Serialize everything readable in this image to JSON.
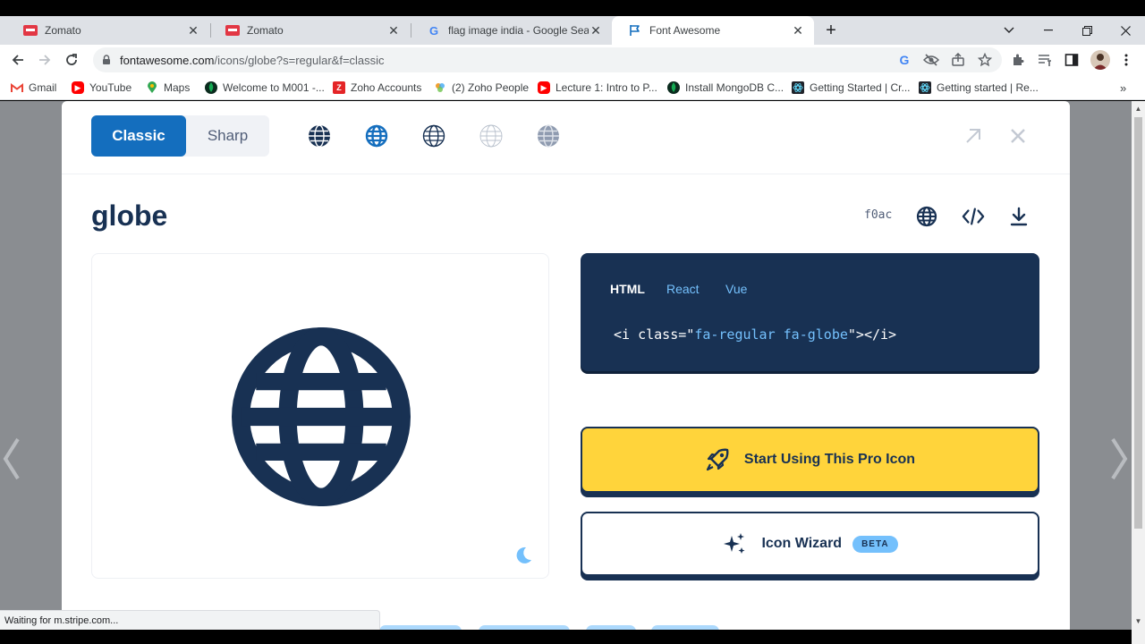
{
  "browser": {
    "tabs": [
      {
        "title": "Zomato",
        "favicon": "zomato-icon",
        "active": false
      },
      {
        "title": "Zomato",
        "favicon": "zomato-icon",
        "active": false
      },
      {
        "title": "flag image india - Google Search",
        "favicon": "google-icon",
        "active": false
      },
      {
        "title": "Font Awesome",
        "favicon": "flag-icon",
        "active": true
      }
    ],
    "url_host": "fontawesome.com",
    "url_path": "/icons/globe?s=regular&f=classic",
    "bookmarks": [
      {
        "label": "Gmail",
        "icon": "gmail-icon"
      },
      {
        "label": "YouTube",
        "icon": "youtube-icon"
      },
      {
        "label": "Maps",
        "icon": "maps-icon"
      },
      {
        "label": "Welcome to M001 -...",
        "icon": "mongodb-icon"
      },
      {
        "label": "Zoho Accounts",
        "icon": "zoho-icon"
      },
      {
        "label": "(2) Zoho People",
        "icon": "zoho-people-icon"
      },
      {
        "label": "Lecture 1: Intro to P...",
        "icon": "youtube-icon"
      },
      {
        "label": "Install MongoDB C...",
        "icon": "mongodb-icon"
      },
      {
        "label": "Getting Started | Cr...",
        "icon": "react-icon"
      },
      {
        "label": "Getting started | Re...",
        "icon": "react-icon"
      }
    ],
    "status": "Waiting for m.stripe.com..."
  },
  "modal": {
    "family_tabs": {
      "classic": "Classic",
      "sharp": "Sharp"
    },
    "icon_name": "globe",
    "unicode": "f0ac",
    "code_tabs": [
      "HTML",
      "React",
      "Vue"
    ],
    "code": {
      "open": "<i class=\"",
      "class_value": "fa-regular fa-globe",
      "close": "\"></i>"
    },
    "pro_button": "Start Using This Pro Icon",
    "wizard_button": "Icon Wizard",
    "wizard_badge": "BETA"
  },
  "colors": {
    "navy": "#183153",
    "blue": "#146ebe",
    "yellow": "#ffd43b",
    "light_blue": "#74c0fc"
  }
}
